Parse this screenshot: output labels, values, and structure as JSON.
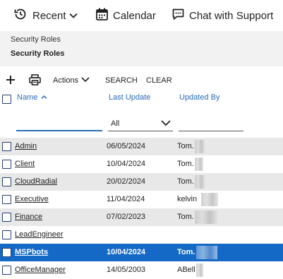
{
  "topbar": {
    "recent_label": "Recent",
    "calendar_label": "Calendar",
    "chat_label": "Chat with Support"
  },
  "breadcrumb": {
    "parent": "Security Roles",
    "current": "Security Roles"
  },
  "toolbar": {
    "actions_label": "Actions",
    "search_label": "SEARCH",
    "clear_label": "CLEAR"
  },
  "table": {
    "headers": {
      "name": "Name",
      "last_update": "Last Update",
      "updated_by": "Updated By"
    },
    "filters": {
      "name_value": "",
      "last_update_selected": "All",
      "updated_by_value": ""
    },
    "rows": [
      {
        "name": "Admin",
        "last_update": "06/05/2024",
        "updated_by": "Tom.",
        "selected": false
      },
      {
        "name": "Client",
        "last_update": "10/04/2024",
        "updated_by": "Tom.",
        "selected": false
      },
      {
        "name": "CloudRadial",
        "last_update": "20/02/2024",
        "updated_by": "Tom.",
        "selected": false
      },
      {
        "name": "Executive",
        "last_update": "11/04/2024",
        "updated_by": "kelvin",
        "selected": false
      },
      {
        "name": "Finance",
        "last_update": "07/02/2023",
        "updated_by": "Tom.",
        "selected": false
      },
      {
        "name": "LeadEngineer",
        "last_update": "",
        "updated_by": "",
        "selected": false
      },
      {
        "name": "MSPbots",
        "last_update": "10/04/2024",
        "updated_by": "Tom.",
        "selected": true
      },
      {
        "name": "OfficeManager",
        "last_update": "14/05/2003",
        "updated_by": "ABell",
        "selected": false
      }
    ]
  },
  "colors": {
    "accent": "#2a6bb8",
    "selected_row": "#1469c7",
    "stripe": "#e8e8e8",
    "breadcrumb_bg": "#f2f2f2"
  }
}
